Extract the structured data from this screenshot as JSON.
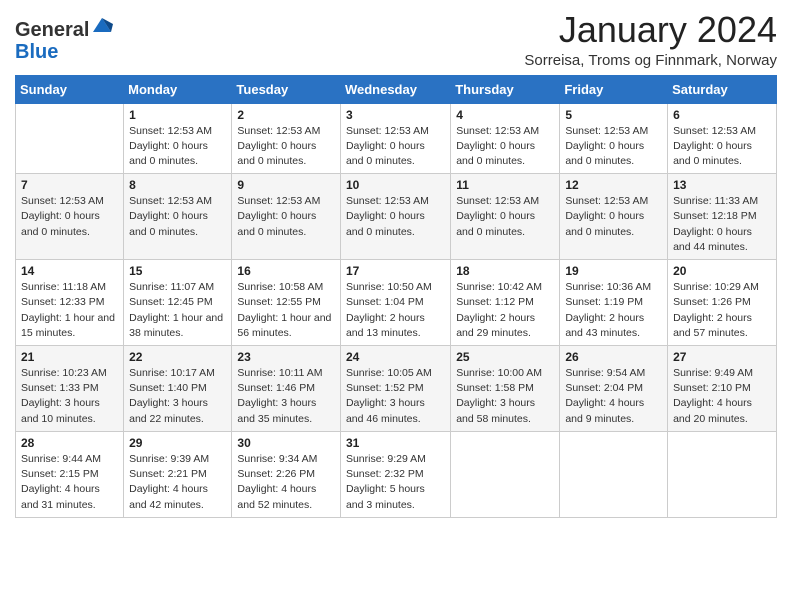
{
  "header": {
    "logo": {
      "general": "General",
      "blue": "Blue"
    },
    "title": "January 2024",
    "subtitle": "Sorreisa, Troms og Finnmark, Norway"
  },
  "columns": [
    "Sunday",
    "Monday",
    "Tuesday",
    "Wednesday",
    "Thursday",
    "Friday",
    "Saturday"
  ],
  "weeks": [
    [
      {
        "day": "",
        "info": ""
      },
      {
        "day": "1",
        "info": "Sunset: 12:53 AM\nDaylight: 0 hours\nand 0 minutes."
      },
      {
        "day": "2",
        "info": "Sunset: 12:53 AM\nDaylight: 0 hours\nand 0 minutes."
      },
      {
        "day": "3",
        "info": "Sunset: 12:53 AM\nDaylight: 0 hours\nand 0 minutes."
      },
      {
        "day": "4",
        "info": "Sunset: 12:53 AM\nDaylight: 0 hours\nand 0 minutes."
      },
      {
        "day": "5",
        "info": "Sunset: 12:53 AM\nDaylight: 0 hours\nand 0 minutes."
      },
      {
        "day": "6",
        "info": "Sunset: 12:53 AM\nDaylight: 0 hours\nand 0 minutes."
      }
    ],
    [
      {
        "day": "7",
        "info": "Sunset: 12:53 AM\nDaylight: 0 hours\nand 0 minutes."
      },
      {
        "day": "8",
        "info": "Sunset: 12:53 AM\nDaylight: 0 hours\nand 0 minutes."
      },
      {
        "day": "9",
        "info": "Sunset: 12:53 AM\nDaylight: 0 hours\nand 0 minutes."
      },
      {
        "day": "10",
        "info": "Sunset: 12:53 AM\nDaylight: 0 hours\nand 0 minutes."
      },
      {
        "day": "11",
        "info": "Sunset: 12:53 AM\nDaylight: 0 hours\nand 0 minutes."
      },
      {
        "day": "12",
        "info": "Sunset: 12:53 AM\nDaylight: 0 hours\nand 0 minutes."
      },
      {
        "day": "13",
        "info": "Sunrise: 11:33 AM\nSunset: 12:18 PM\nDaylight: 0 hours\nand 44 minutes."
      }
    ],
    [
      {
        "day": "14",
        "info": "Sunrise: 11:18 AM\nSunset: 12:33 PM\nDaylight: 1 hour and\n15 minutes."
      },
      {
        "day": "15",
        "info": "Sunrise: 11:07 AM\nSunset: 12:45 PM\nDaylight: 1 hour and\n38 minutes."
      },
      {
        "day": "16",
        "info": "Sunrise: 10:58 AM\nSunset: 12:55 PM\nDaylight: 1 hour and\n56 minutes."
      },
      {
        "day": "17",
        "info": "Sunrise: 10:50 AM\nSunset: 1:04 PM\nDaylight: 2 hours\nand 13 minutes."
      },
      {
        "day": "18",
        "info": "Sunrise: 10:42 AM\nSunset: 1:12 PM\nDaylight: 2 hours\nand 29 minutes."
      },
      {
        "day": "19",
        "info": "Sunrise: 10:36 AM\nSunset: 1:19 PM\nDaylight: 2 hours\nand 43 minutes."
      },
      {
        "day": "20",
        "info": "Sunrise: 10:29 AM\nSunset: 1:26 PM\nDaylight: 2 hours\nand 57 minutes."
      }
    ],
    [
      {
        "day": "21",
        "info": "Sunrise: 10:23 AM\nSunset: 1:33 PM\nDaylight: 3 hours\nand 10 minutes."
      },
      {
        "day": "22",
        "info": "Sunrise: 10:17 AM\nSunset: 1:40 PM\nDaylight: 3 hours\nand 22 minutes."
      },
      {
        "day": "23",
        "info": "Sunrise: 10:11 AM\nSunset: 1:46 PM\nDaylight: 3 hours\nand 35 minutes."
      },
      {
        "day": "24",
        "info": "Sunrise: 10:05 AM\nSunset: 1:52 PM\nDaylight: 3 hours\nand 46 minutes."
      },
      {
        "day": "25",
        "info": "Sunrise: 10:00 AM\nSunset: 1:58 PM\nDaylight: 3 hours\nand 58 minutes."
      },
      {
        "day": "26",
        "info": "Sunrise: 9:54 AM\nSunset: 2:04 PM\nDaylight: 4 hours\nand 9 minutes."
      },
      {
        "day": "27",
        "info": "Sunrise: 9:49 AM\nSunset: 2:10 PM\nDaylight: 4 hours\nand 20 minutes."
      }
    ],
    [
      {
        "day": "28",
        "info": "Sunrise: 9:44 AM\nSunset: 2:15 PM\nDaylight: 4 hours\nand 31 minutes."
      },
      {
        "day": "29",
        "info": "Sunrise: 9:39 AM\nSunset: 2:21 PM\nDaylight: 4 hours\nand 42 minutes."
      },
      {
        "day": "30",
        "info": "Sunrise: 9:34 AM\nSunset: 2:26 PM\nDaylight: 4 hours\nand 52 minutes."
      },
      {
        "day": "31",
        "info": "Sunrise: 9:29 AM\nSunset: 2:32 PM\nDaylight: 5 hours\nand 3 minutes."
      },
      {
        "day": "",
        "info": ""
      },
      {
        "day": "",
        "info": ""
      },
      {
        "day": "",
        "info": ""
      }
    ]
  ]
}
